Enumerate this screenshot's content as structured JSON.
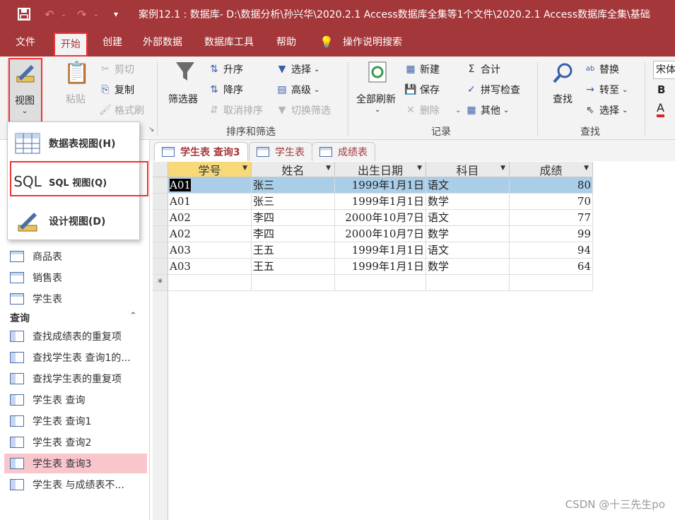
{
  "titlebar": {
    "save_icon": "save-icon",
    "undo_icon": "undo-icon",
    "redo_icon": "redo-icon",
    "title": "案例12.1 : 数据库- D:\\数据分析\\孙兴华\\2020.2.1 Access数据库全集等1个文件\\2020.2.1 Access数据库全集\\基础"
  },
  "menu": {
    "tabs": [
      "文件",
      "开始",
      "创建",
      "外部数据",
      "数据库工具",
      "帮助"
    ],
    "active_index": 1,
    "search_label": "操作说明搜索"
  },
  "ribbon": {
    "view": {
      "label": "视图"
    },
    "clipboard": {
      "paste": "粘贴",
      "cut": "剪切",
      "copy": "复制",
      "format_painter": "格式刷"
    },
    "sort_filter": {
      "filter": "筛选器",
      "asc": "升序",
      "desc": "降序",
      "remove_sort": "取消排序",
      "selection": "选择",
      "advanced": "高级",
      "toggle_filter": "切换筛选",
      "group_label": "排序和筛选"
    },
    "records": {
      "refresh_all": "全部刷新",
      "new": "新建",
      "save": "保存",
      "delete": "删除",
      "totals": "合计",
      "spelling": "拼写检查",
      "more": "其他",
      "group_label": "记录"
    },
    "find": {
      "find": "查找",
      "replace": "替换",
      "goto": "转至",
      "select": "选择",
      "group_label": "查找"
    },
    "text_format": {
      "font": "宋体",
      "bold": "B",
      "font_color": "A"
    }
  },
  "view_menu": {
    "items": [
      {
        "label": "数据表视图(H)",
        "icon": "datasheet-view-icon"
      },
      {
        "label": "SQL 视图(Q)",
        "icon_text": "SQL"
      },
      {
        "label": "设计视图(D)",
        "icon": "design-view-icon"
      }
    ]
  },
  "navpane": {
    "tables": [
      "商品表",
      "销售表",
      "学生表"
    ],
    "queries_header": "查询",
    "queries": [
      "查找成绩表的重复项",
      "查找学生表 查询1的...",
      "查找学生表的重复项",
      "学生表 查询",
      "学生表 查询1",
      "学生表 查询2",
      "学生表 查询3",
      "学生表 与成绩表不..."
    ],
    "selected_query_index": 6
  },
  "doc_tabs": [
    {
      "label": "学生表 查询3",
      "active": true
    },
    {
      "label": "学生表",
      "active": false
    },
    {
      "label": "成绩表",
      "active": false
    }
  ],
  "datasheet": {
    "columns": [
      "学号",
      "姓名",
      "出生日期",
      "科目",
      "成绩"
    ],
    "rows": [
      [
        "A01",
        "张三",
        "1999年1月1日",
        "语文",
        "80"
      ],
      [
        "A01",
        "张三",
        "1999年1月1日",
        "数学",
        "70"
      ],
      [
        "A02",
        "李四",
        "2000年10月7日",
        "语文",
        "77"
      ],
      [
        "A02",
        "李四",
        "2000年10月7日",
        "数学",
        "99"
      ],
      [
        "A03",
        "王五",
        "1999年1月1日",
        "语文",
        "94"
      ],
      [
        "A03",
        "王五",
        "1999年1月1日",
        "数学",
        "64"
      ]
    ],
    "new_row_marker": "*",
    "selected_row_index": 0
  },
  "watermark": "CSDN @十三先生po"
}
